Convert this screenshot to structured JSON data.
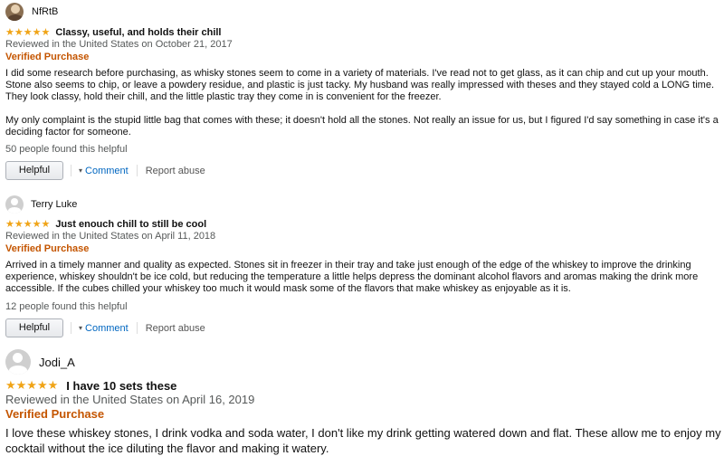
{
  "reviews": [
    {
      "user": "NfRtB",
      "stars": "★★★★★",
      "title": "Classy, useful, and holds their chill",
      "date": "Reviewed in the United States on October 21, 2017",
      "verified": "Verified Purchase",
      "body": [
        "I did some research before purchasing, as whisky stones seem to come in a variety of materials. I've read not to get glass, as it can chip and cut up your mouth. Stone also seems to chip, or leave a powdery residue, and plastic is just tacky. My husband was really impressed with theses and they stayed cold a LONG time. They look classy, hold their chill, and the little plastic tray they come in is convenient for the freezer.",
        "My only complaint is the stupid little bag that comes with these; it doesn't hold all the stones. Not really an issue for us, but I figured I'd say something in case it's a deciding factor for someone."
      ],
      "helpful_count": "50 people found this helpful",
      "helpful_label": "Helpful",
      "comment_label": "Comment",
      "abuse_label": "Report abuse"
    },
    {
      "user": "Terry Luke",
      "stars": "★★★★★",
      "title": "Just enouch chill to still be cool",
      "date": "Reviewed in the United States on April 11, 2018",
      "verified": "Verified Purchase",
      "body": [
        "Arrived in a timely manner and quality as expected. Stones sit in freezer in their tray and take just enough of the edge of the whiskey to improve the drinking experience, whiskey shouldn't be ice cold, but reducing the temperature a little helps depress the dominant alcohol flavors and aromas making the drink more accessible. If the cubes chilled your whiskey too much it would mask some of the flavors that make whiskey as enjoyable as it is."
      ],
      "helpful_count": "12 people found this helpful",
      "helpful_label": "Helpful",
      "comment_label": "Comment",
      "abuse_label": "Report abuse"
    },
    {
      "user": "Jodi_A",
      "stars": "★★★★★",
      "title": "I have 10 sets these",
      "date": "Reviewed in the United States on April 16, 2019",
      "verified": "Verified Purchase",
      "body": [
        "I love these whiskey stones, I drink vodka and soda water, I don't like my drink getting watered down and flat. These allow me to enjoy my cocktail without the ice diluting the flavor and making it watery."
      ]
    }
  ],
  "icons": {
    "star": "star-icon",
    "avatar": "default-avatar-icon",
    "chevron": "chevron-down-icon"
  },
  "colors": {
    "star": "#f0a417",
    "verified": "#c45500",
    "link": "#0066c0",
    "meta": "#565959"
  }
}
